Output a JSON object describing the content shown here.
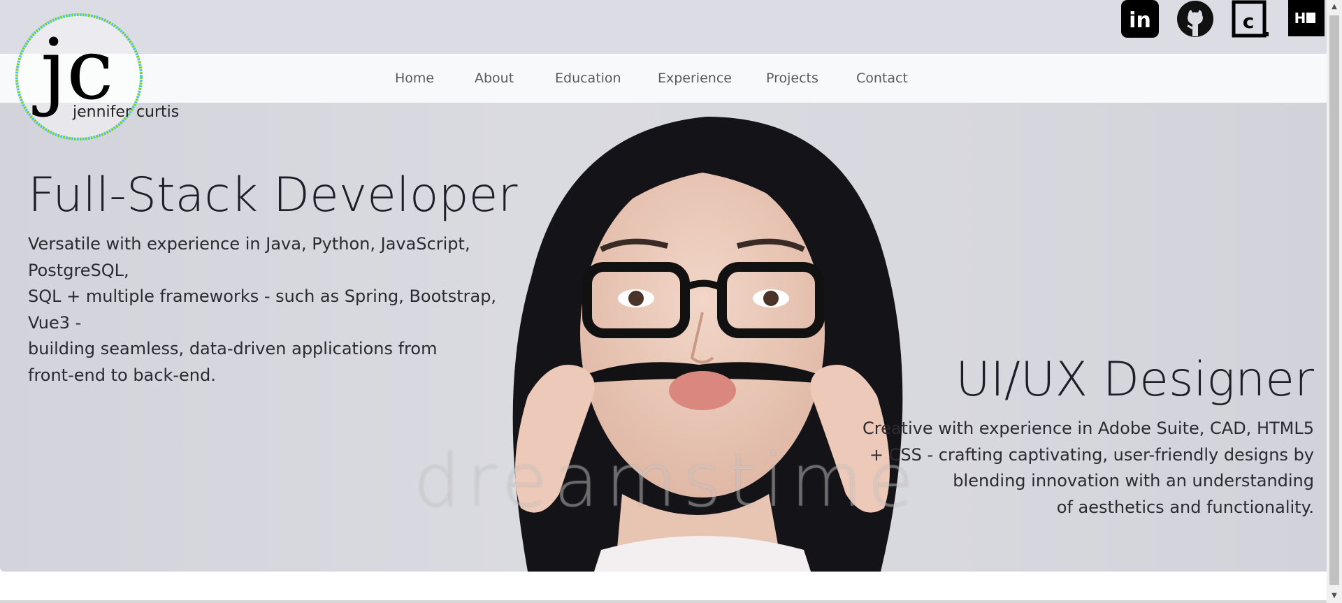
{
  "brand": {
    "monogram": "jc",
    "name": "jennifer curtis",
    "ring_colors": [
      "#7ed321",
      "#4fc3f7"
    ]
  },
  "social": [
    {
      "name": "linkedin-icon",
      "glyph": "in"
    },
    {
      "name": "github-icon",
      "glyph": ""
    },
    {
      "name": "codepen-icon",
      "glyph": "c"
    },
    {
      "name": "handshake-icon",
      "glyph": "H"
    }
  ],
  "nav": {
    "items": [
      "Home",
      "About",
      "Education",
      "Experience",
      "Projects",
      "Contact"
    ]
  },
  "hero": {
    "left": {
      "title": "Full-Stack Developer",
      "line1": "Versatile with experience in Java, Python, JavaScript, PostgreSQL,",
      "line2": "SQL + multiple frameworks - such as Spring, Bootstrap, Vue3 -",
      "line3": "building seamless, data-driven applications from",
      "line4": "front-end to back-end."
    },
    "right": {
      "title": "UI/UX Designer",
      "line1": "Creative with experience in Adobe Suite, CAD, HTML5",
      "line2": "+ CSS - crafting captivating, user-friendly designs by",
      "line3": "blending innovation with an understanding",
      "line4": "of aesthetics and functionality."
    },
    "watermark": "dreamstime"
  },
  "colors": {
    "topbar": "#dcdce4",
    "navbar": "#f8f9fa",
    "hero_bg": "#d8d8df",
    "text_dark": "#1e1e28"
  }
}
